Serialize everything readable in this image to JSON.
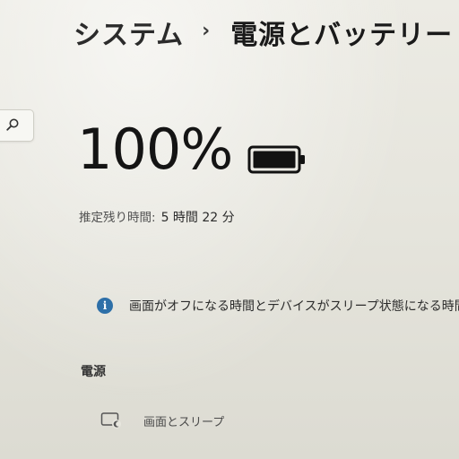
{
  "header": {
    "breadcrumb_parent": "システム",
    "breadcrumb_separator": "›",
    "page_title": "電源とバッテリー"
  },
  "search": {
    "icon": "search-icon"
  },
  "battery": {
    "percent_label": "100%",
    "charge_level": 1.0,
    "icon": "battery-full-icon",
    "remaining_label": "推定残り時間:",
    "remaining_value": "5 時間 22 分"
  },
  "info": {
    "icon": "info-icon",
    "icon_glyph": "i",
    "text": "画面がオフになる時間とデバイスがスリープ状態になる時間",
    "color": "#2d6fa8"
  },
  "power_section": {
    "heading": "電源",
    "items": [
      {
        "icon": "screen-sleep-icon",
        "label": "画面とスリープ"
      }
    ]
  }
}
